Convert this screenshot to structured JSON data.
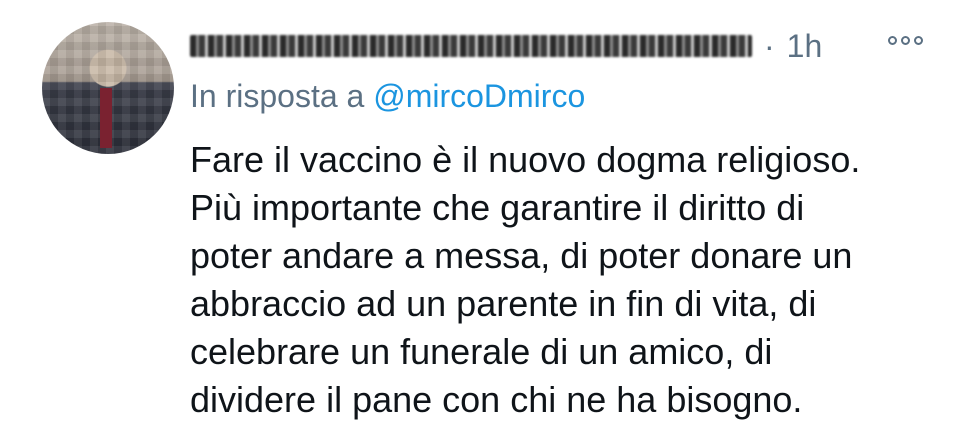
{
  "tweet": {
    "separator": "·",
    "time": "1h",
    "reply_prefix": "In risposta a",
    "reply_handle": "@mircoDmirco",
    "text_lines": [
      "Fare il vaccino è il nuovo dogma religioso.",
      "Più importante che garantire il diritto di",
      "poter andare a messa, di poter donare un",
      "abbraccio ad un parente in fin di vita, di",
      "celebrare un funerale di un amico, di",
      "dividere il pane con chi ne ha bisogno."
    ]
  },
  "icons": {
    "more": "more-options-icon"
  },
  "colors": {
    "muted": "#5b7083",
    "link": "#1b95e0",
    "text": "#0f1419"
  }
}
